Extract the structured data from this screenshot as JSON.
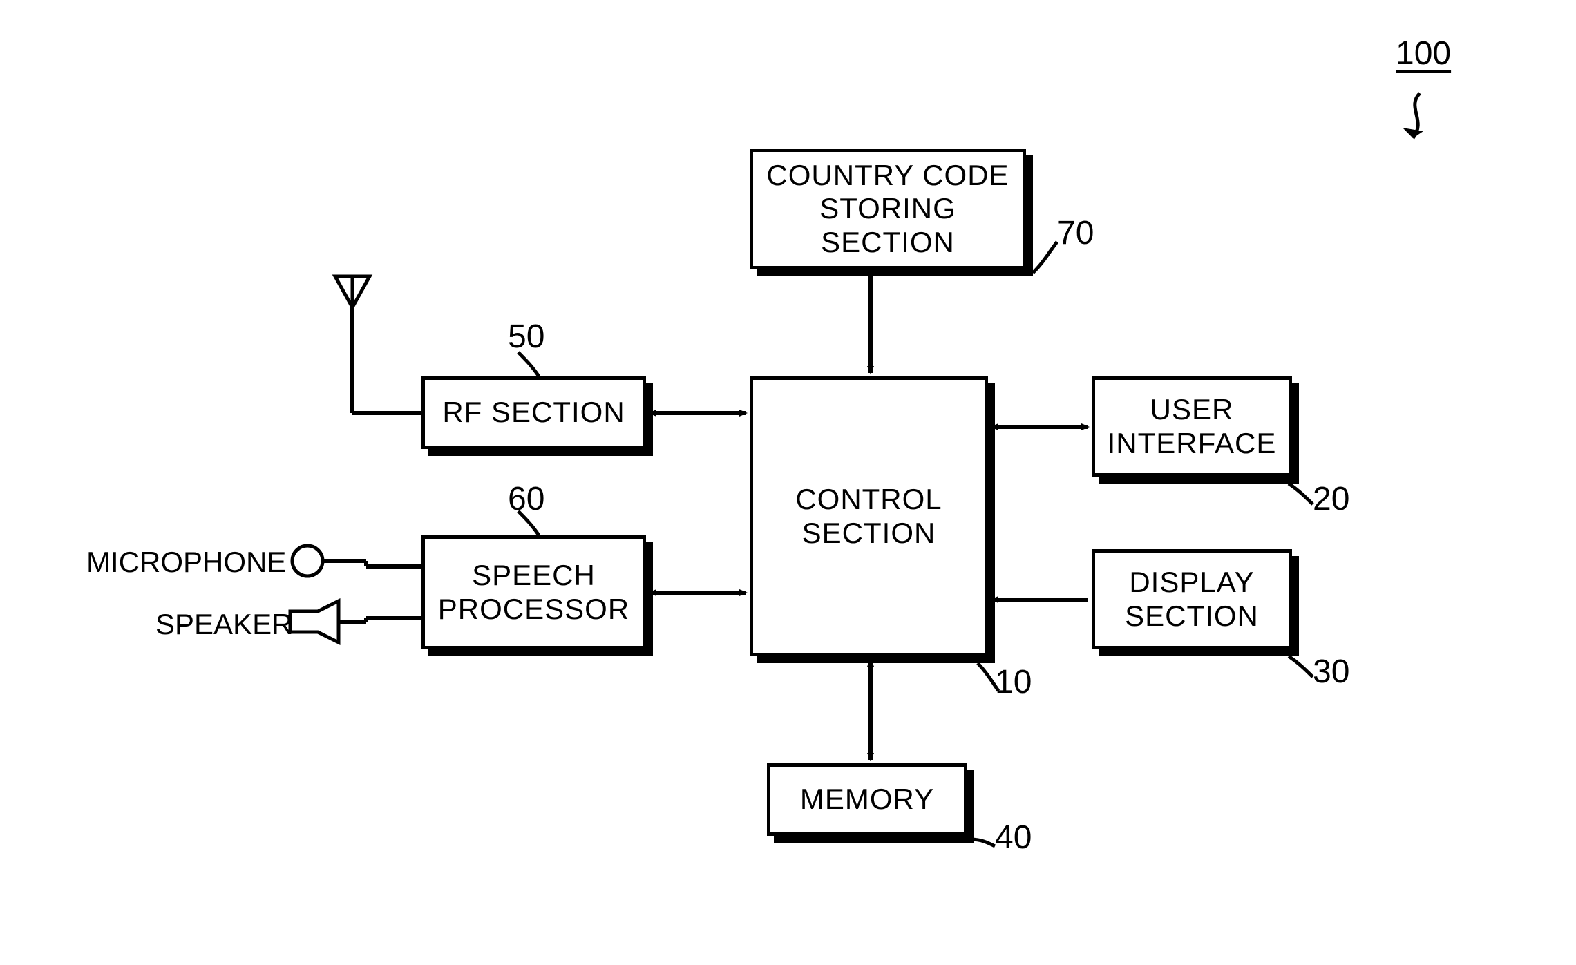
{
  "diagram": {
    "ref": "100",
    "blocks": {
      "control": {
        "label": "CONTROL\nSECTION",
        "ref": "10"
      },
      "country": {
        "label": "COUNTRY CODE\nSTORING\nSECTION",
        "ref": "70"
      },
      "rf": {
        "label": "RF SECTION",
        "ref": "50"
      },
      "speech": {
        "label": "SPEECH\nPROCESSOR",
        "ref": "60"
      },
      "user": {
        "label": "USER\nINTERFACE",
        "ref": "20"
      },
      "display": {
        "label": "DISPLAY\nSECTION",
        "ref": "30"
      },
      "memory": {
        "label": "MEMORY",
        "ref": "40"
      }
    },
    "io": {
      "mic": "MICROPHONE",
      "spk": "SPEAKER"
    }
  }
}
